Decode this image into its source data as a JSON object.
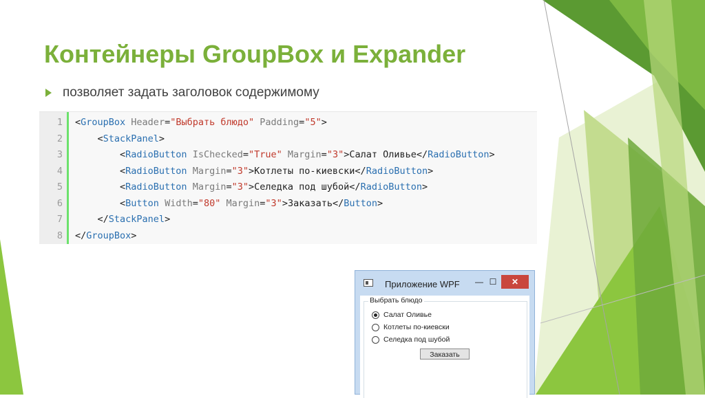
{
  "slide": {
    "title": "Контейнеры GroupBox и Expander",
    "bullet": "позволяет задать заголовок содержимому",
    "accent_color": "#7bb03a"
  },
  "code": {
    "lines": [
      {
        "number": "1",
        "parts": [
          {
            "k": "x",
            "t": ""
          },
          {
            "k": "x",
            "t": "<"
          },
          {
            "k": "t",
            "t": "GroupBox"
          },
          {
            "k": "a",
            "t": " Header"
          },
          {
            "k": "x",
            "t": "="
          },
          {
            "k": "v",
            "t": "\"Выбрать блюдо\""
          },
          {
            "k": "a",
            "t": " Padding"
          },
          {
            "k": "x",
            "t": "="
          },
          {
            "k": "v",
            "t": "\"5\""
          },
          {
            "k": "x",
            "t": ">"
          }
        ]
      },
      {
        "number": "2",
        "parts": [
          {
            "k": "x",
            "t": "    <"
          },
          {
            "k": "t",
            "t": "StackPanel"
          },
          {
            "k": "x",
            "t": ">"
          }
        ]
      },
      {
        "number": "3",
        "parts": [
          {
            "k": "x",
            "t": "        <"
          },
          {
            "k": "t",
            "t": "RadioButton"
          },
          {
            "k": "a",
            "t": " IsChecked"
          },
          {
            "k": "x",
            "t": "="
          },
          {
            "k": "v",
            "t": "\"True\""
          },
          {
            "k": "a",
            "t": " Margin"
          },
          {
            "k": "x",
            "t": "="
          },
          {
            "k": "v",
            "t": "\"3\""
          },
          {
            "k": "x",
            "t": ">Салат Оливье</"
          },
          {
            "k": "t",
            "t": "RadioButton"
          },
          {
            "k": "x",
            "t": ">"
          }
        ]
      },
      {
        "number": "4",
        "parts": [
          {
            "k": "x",
            "t": "        <"
          },
          {
            "k": "t",
            "t": "RadioButton"
          },
          {
            "k": "a",
            "t": " Margin"
          },
          {
            "k": "x",
            "t": "="
          },
          {
            "k": "v",
            "t": "\"3\""
          },
          {
            "k": "x",
            "t": ">Котлеты по-киевски</"
          },
          {
            "k": "t",
            "t": "RadioButton"
          },
          {
            "k": "x",
            "t": ">"
          }
        ]
      },
      {
        "number": "5",
        "parts": [
          {
            "k": "x",
            "t": "        <"
          },
          {
            "k": "t",
            "t": "RadioButton"
          },
          {
            "k": "a",
            "t": " Margin"
          },
          {
            "k": "x",
            "t": "="
          },
          {
            "k": "v",
            "t": "\"3\""
          },
          {
            "k": "x",
            "t": ">Селедка под шубой</"
          },
          {
            "k": "t",
            "t": "RadioButton"
          },
          {
            "k": "x",
            "t": ">"
          }
        ]
      },
      {
        "number": "6",
        "parts": [
          {
            "k": "x",
            "t": "        <"
          },
          {
            "k": "t",
            "t": "Button"
          },
          {
            "k": "a",
            "t": " Width"
          },
          {
            "k": "x",
            "t": "="
          },
          {
            "k": "v",
            "t": "\"80\""
          },
          {
            "k": "a",
            "t": " Margin"
          },
          {
            "k": "x",
            "t": "="
          },
          {
            "k": "v",
            "t": "\"3\""
          },
          {
            "k": "x",
            "t": ">Заказать</"
          },
          {
            "k": "t",
            "t": "Button"
          },
          {
            "k": "x",
            "t": ">"
          }
        ]
      },
      {
        "number": "7",
        "parts": [
          {
            "k": "x",
            "t": "    </"
          },
          {
            "k": "t",
            "t": "StackPanel"
          },
          {
            "k": "x",
            "t": ">"
          }
        ]
      },
      {
        "number": "8",
        "parts": [
          {
            "k": "x",
            "t": "</"
          },
          {
            "k": "t",
            "t": "GroupBox"
          },
          {
            "k": "x",
            "t": ">"
          }
        ]
      }
    ]
  },
  "window": {
    "title": "Приложение WPF",
    "minimize_glyph": "—",
    "maximize_glyph": "☐",
    "close_glyph": "✕",
    "group_header": "Выбрать блюдо",
    "options": [
      {
        "label": "Салат Оливье",
        "checked": true
      },
      {
        "label": "Котлеты по-киевски",
        "checked": false
      },
      {
        "label": "Селедка под шубой",
        "checked": false
      }
    ],
    "order_button": "Заказать"
  }
}
